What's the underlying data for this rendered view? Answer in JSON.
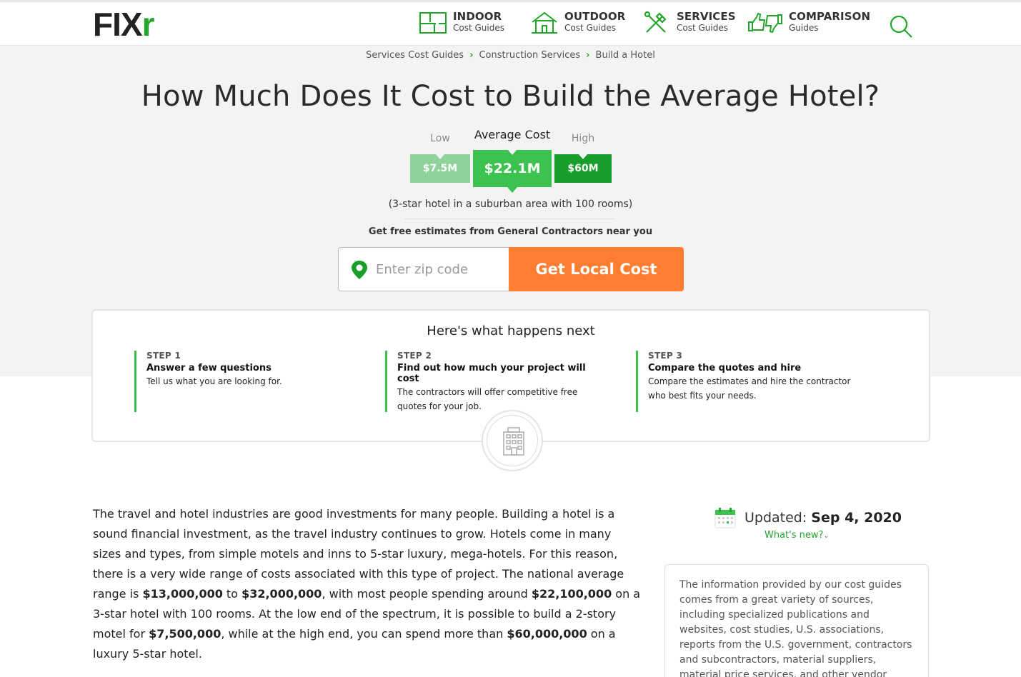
{
  "header": {
    "logo_main": "FIX",
    "logo_accent": "r",
    "nav": [
      {
        "title": "INDOOR",
        "sub": "Cost Guides",
        "icon": "indoor-floorplan-icon"
      },
      {
        "title": "OUTDOOR",
        "sub": "Cost Guides",
        "icon": "outdoor-house-icon"
      },
      {
        "title": "SERVICES",
        "sub": "Cost Guides",
        "icon": "services-tools-icon"
      },
      {
        "title": "COMPARISON",
        "sub": "Guides",
        "icon": "comparison-thumbs-icon"
      }
    ],
    "search_icon": "search-icon"
  },
  "breadcrumb": [
    "Services Cost Guides",
    "Construction Services",
    "Build a Hotel"
  ],
  "title": "How Much Does It Cost to Build the Average Hotel?",
  "cost": {
    "low_label": "Low",
    "low_value": "$7.5M",
    "avg_label": "Average Cost",
    "avg_value": "$22.1M",
    "high_label": "High",
    "high_value": "$60M",
    "colors": {
      "low": "#8fd29a",
      "avg": "#3bc24f",
      "high": "#1a9e2b"
    }
  },
  "note": "(3-star hotel in a suburban area with 100 rooms)",
  "estimate": {
    "heading": "Get free estimates from General Contractors near you",
    "zip_placeholder": "Enter zip code",
    "button_label": "Get Local Cost",
    "button_color": "#fd7e31"
  },
  "steps": {
    "heading": "Here's what happens next",
    "items": [
      {
        "num": "STEP 1",
        "head": "Answer a few questions",
        "desc": "Tell us what you are looking for."
      },
      {
        "num": "STEP 2",
        "head": "Find out how much your project will cost",
        "desc": "The contractors will offer competitive free quotes for your job."
      },
      {
        "num": "STEP 3",
        "head": "Compare the quotes and hire",
        "desc": "Compare the estimates and hire the contractor who best fits your needs."
      }
    ]
  },
  "article": {
    "p1_a": "The travel and hotel industries are good investments for many people. Building a hotel is a sound financial investment, as the travel industry continues to grow. Hotels come in many sizes and types, from simple motels and inns to 5-star luxury, mega-hotels. For this reason, there is a very wide range of costs associated with this type of project. The national average range is ",
    "b1": "$13,000,000",
    "p1_b": " to ",
    "b2": "$32,000,000",
    "p1_c": ", with most people spending around ",
    "b3": "$22,100,000",
    "p1_d": " on a 3-star hotel with 100 rooms. At the low end of the spectrum, it is possible to build a 2-story motel for ",
    "b4": "$7,500,000",
    "p1_e": ", while at the high end, you can spend more than ",
    "b5": "$60,000,000",
    "p1_f": " on a luxury 5-star hotel."
  },
  "sidebar": {
    "updated_label": "Updated:",
    "updated_date": "Sep 4, 2020",
    "whats_new": "What's new?",
    "info": "The information provided by our cost guides comes from a great variety of sources, including specialized publications and websites, cost studies, U.S. associations, reports from the U.S. government, contractors and subcontractors, material suppliers, material price services, and other vendor"
  }
}
